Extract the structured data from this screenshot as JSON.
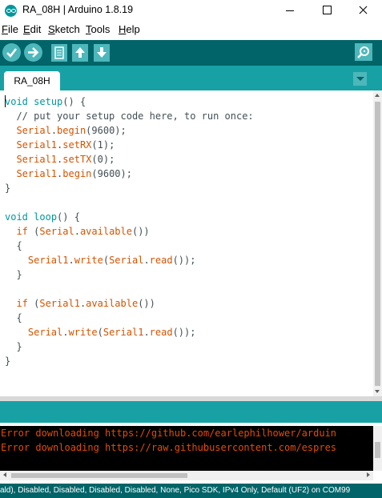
{
  "window": {
    "title": "RA_08H | Arduino 1.8.19",
    "icon": "arduino-icon"
  },
  "menu": {
    "file": {
      "u": "F",
      "rest": "ile"
    },
    "edit": {
      "u": "E",
      "rest": "dit"
    },
    "sketch": {
      "u": "S",
      "rest": "ketch"
    },
    "tools": {
      "u": "T",
      "rest": "ools"
    },
    "help": {
      "u": "H",
      "rest": "elp"
    }
  },
  "toolbar": {
    "buttons": [
      "verify-icon",
      "upload-icon",
      "new-icon",
      "open-icon",
      "save-icon"
    ],
    "serial_monitor": "serial-monitor-icon"
  },
  "tabs": [
    {
      "label": "RA_08H",
      "active": true
    }
  ],
  "editor": {
    "lines": [
      [
        {
          "t": "void",
          "c": "kw"
        },
        {
          "t": " "
        },
        {
          "t": "setup",
          "c": "kw"
        },
        {
          "t": "() {"
        }
      ],
      [
        {
          "t": "  // put your setup code here, to run once:",
          "c": "cm"
        }
      ],
      [
        {
          "t": "  "
        },
        {
          "t": "Serial",
          "c": "fn"
        },
        {
          "t": "."
        },
        {
          "t": "begin",
          "c": "fn"
        },
        {
          "t": "(9600);"
        }
      ],
      [
        {
          "t": "  "
        },
        {
          "t": "Serial1",
          "c": "fn"
        },
        {
          "t": "."
        },
        {
          "t": "setRX",
          "c": "fn"
        },
        {
          "t": "(1);"
        }
      ],
      [
        {
          "t": "  "
        },
        {
          "t": "Serial1",
          "c": "fn"
        },
        {
          "t": "."
        },
        {
          "t": "setTX",
          "c": "fn"
        },
        {
          "t": "(0);"
        }
      ],
      [
        {
          "t": "  "
        },
        {
          "t": "Serial1",
          "c": "fn"
        },
        {
          "t": "."
        },
        {
          "t": "begin",
          "c": "fn"
        },
        {
          "t": "(9600);"
        }
      ],
      [
        {
          "t": "}"
        }
      ],
      [
        {
          "t": ""
        }
      ],
      [
        {
          "t": "void",
          "c": "kw"
        },
        {
          "t": " "
        },
        {
          "t": "loop",
          "c": "kw"
        },
        {
          "t": "() {"
        }
      ],
      [
        {
          "t": "  "
        },
        {
          "t": "if",
          "c": "fn"
        },
        {
          "t": " ("
        },
        {
          "t": "Serial",
          "c": "fn"
        },
        {
          "t": "."
        },
        {
          "t": "available",
          "c": "fn"
        },
        {
          "t": "())"
        }
      ],
      [
        {
          "t": "  {"
        }
      ],
      [
        {
          "t": "    "
        },
        {
          "t": "Serial1",
          "c": "fn"
        },
        {
          "t": "."
        },
        {
          "t": "write",
          "c": "fn"
        },
        {
          "t": "("
        },
        {
          "t": "Serial",
          "c": "fn"
        },
        {
          "t": "."
        },
        {
          "t": "read",
          "c": "fn"
        },
        {
          "t": "());"
        }
      ],
      [
        {
          "t": "  }"
        }
      ],
      [
        {
          "t": ""
        }
      ],
      [
        {
          "t": "  "
        },
        {
          "t": "if",
          "c": "fn"
        },
        {
          "t": " ("
        },
        {
          "t": "Serial1",
          "c": "fn"
        },
        {
          "t": "."
        },
        {
          "t": "available",
          "c": "fn"
        },
        {
          "t": "())"
        }
      ],
      [
        {
          "t": "  {"
        }
      ],
      [
        {
          "t": "    "
        },
        {
          "t": "Serial",
          "c": "fn"
        },
        {
          "t": "."
        },
        {
          "t": "write",
          "c": "fn"
        },
        {
          "t": "("
        },
        {
          "t": "Serial1",
          "c": "fn"
        },
        {
          "t": "."
        },
        {
          "t": "read",
          "c": "fn"
        },
        {
          "t": "());"
        }
      ],
      [
        {
          "t": "  }"
        }
      ],
      [
        {
          "t": "}"
        }
      ]
    ]
  },
  "console": {
    "lines": [
      "Error downloading https://github.com/earlephilhower/arduin",
      "Error downloading https://raw.githubusercontent.com/espres"
    ]
  },
  "statusbar": {
    "text": "ald), Disabled, Disabled, Disabled, Disabled, None, Pico SDK, IPv4 Only, Default (UF2) on COM99"
  },
  "colors": {
    "toolbar": "#006468",
    "tabbar": "#17a1a5",
    "button": "#4db7bb",
    "keyword": "#00979c",
    "function": "#d35400",
    "console_error": "#e34c00"
  }
}
